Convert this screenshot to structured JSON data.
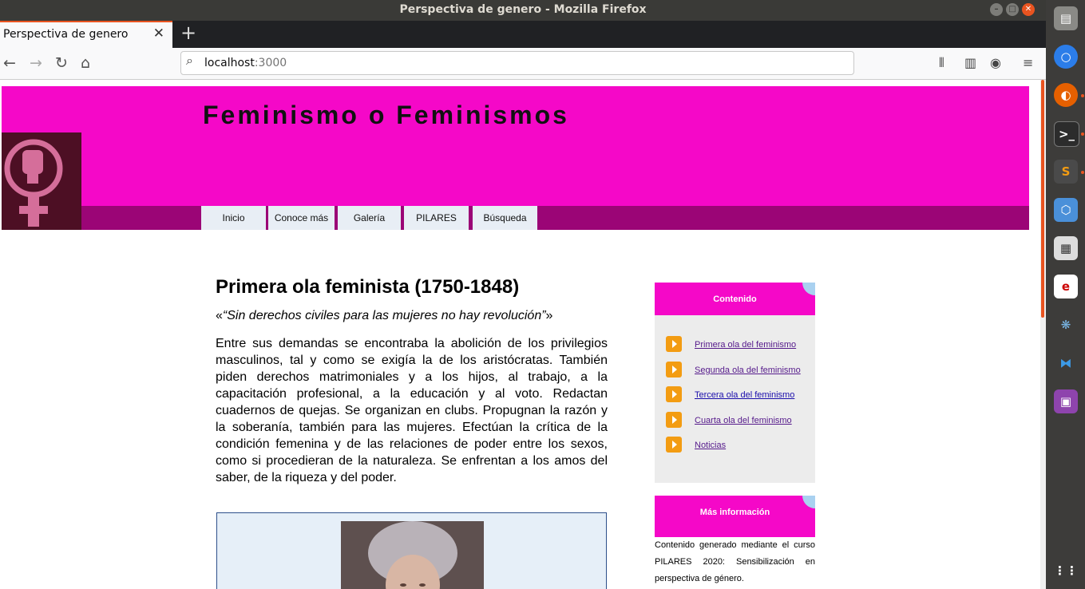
{
  "window": {
    "title": "Perspectiva de genero - Mozilla Firefox"
  },
  "tab": {
    "title": "Perspectiva de genero",
    "new_tab": "+"
  },
  "address": {
    "host": "localhost",
    "port": ":3000"
  },
  "site": {
    "title": "Feminismo o Feminismos",
    "menu": [
      "Inicio",
      "Conoce más",
      "Galería",
      "PILARES",
      "Búsqueda"
    ]
  },
  "article": {
    "heading": "Primera ola feminista (1750-1848)",
    "quote_open": "«",
    "quote": "“Sin derechos civiles para las mujeres no hay revolución”",
    "quote_close": "»",
    "paragraph": "Entre sus demandas se encontraba la abolición de los privilegios masculinos, tal y como se exigía la de los aristócratas. También piden derechos matrimoniales y a los hijos, al trabajo, a la capacitación profesional, a la educación y al voto. Redactan cuadernos de quejas. Se organizan en clubs. Propugnan la razón y la soberanía, también para las mujeres. Efectúan la crítica de la condición femenina y de las relaciones de poder entre los sexos, como si procedieran de la naturaleza. Se enfrentan a los amos del saber, de la riqueza y del poder."
  },
  "sidebar": {
    "contents_title": "Contenido",
    "links": [
      "Primera ola del feminismo",
      "Segunda ola del feminismo",
      "Tercera ola del feminismo",
      "Cuarta ola del feminismo",
      "Noticias"
    ],
    "more_title": "Más información",
    "more_text": "Contenido generado mediante el curso PILARES 2020: Sensibilización en perspectiva de género."
  },
  "colors": {
    "banner": "#f508c8",
    "menubar": "#9b0576",
    "accent": "#e95420"
  }
}
